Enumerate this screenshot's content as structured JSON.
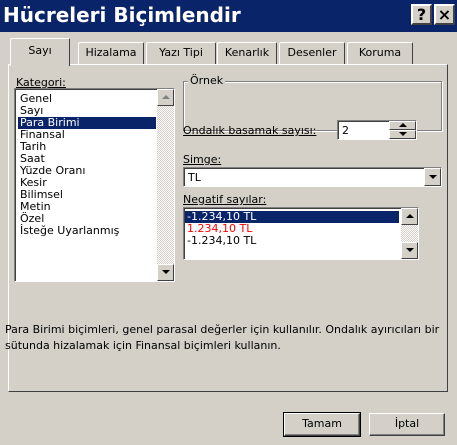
{
  "window": {
    "title": "Hücreleri Biçimlendir",
    "help_glyph": "?",
    "close_glyph": "×"
  },
  "tabs": [
    {
      "label": "Sayı",
      "active": true
    },
    {
      "label": "Hizalama"
    },
    {
      "label": "Yazı Tipi"
    },
    {
      "label": "Kenarlık"
    },
    {
      "label": "Desenler"
    },
    {
      "label": "Koruma"
    }
  ],
  "category": {
    "label": "Kategori:",
    "items": [
      "Genel",
      "Sayı",
      "Para Birimi",
      "Finansal",
      "Tarih",
      "Saat",
      "Yüzde Oranı",
      "Kesir",
      "Bilimsel",
      "Metin",
      "Özel",
      "İsteğe Uyarlanmış"
    ],
    "selected": "Para Birimi"
  },
  "sample": {
    "title": "Örnek",
    "value": ""
  },
  "decimal": {
    "label": "Ondalık basamak sayısı:",
    "value": "2"
  },
  "symbol": {
    "label": "Simge:",
    "value": "TL"
  },
  "negative": {
    "label": "Negatif sayılar:",
    "items": [
      {
        "text": "-1.234,10 TL",
        "color": "#000000",
        "selected": true
      },
      {
        "text": "1.234,10 TL",
        "color": "#ff0000"
      },
      {
        "text": "-1.234,10 TL",
        "color": "#000000"
      }
    ]
  },
  "description": "Para Birimi biçimleri, genel parasal değerler için kullanılır. Ondalık ayırıcıları bir sütunda hizalamak için Finansal biçimleri kullanın.",
  "buttons": {
    "ok": "Tamam",
    "cancel": "İptal"
  }
}
